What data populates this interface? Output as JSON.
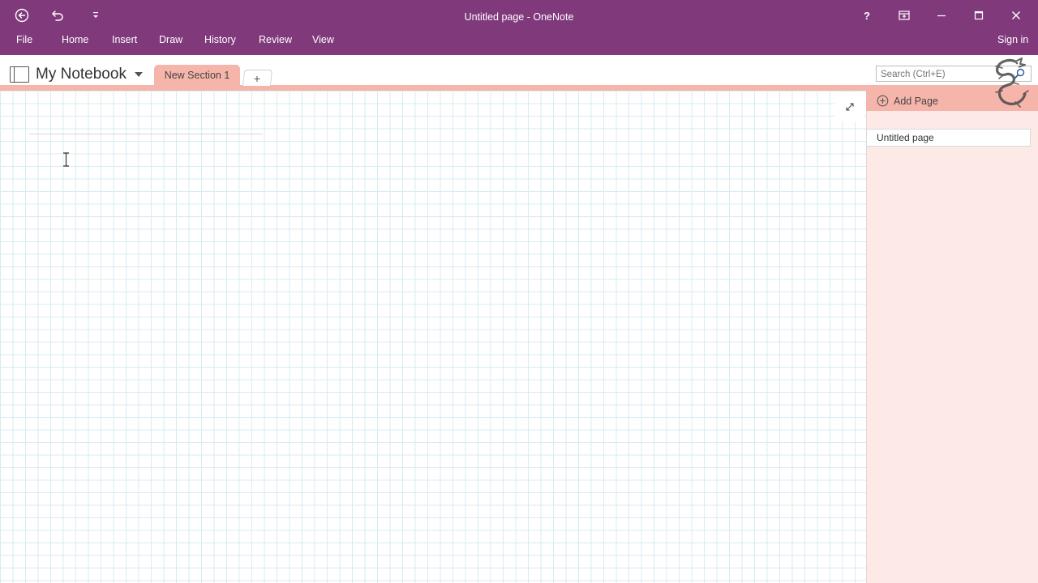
{
  "window": {
    "title": "Untitled page - OneNote"
  },
  "quick_access": {
    "back_icon": "back-arrow-circle-icon",
    "undo_icon": "undo-icon",
    "customize_icon": "customize-toolbar-icon"
  },
  "window_controls": {
    "help": "?",
    "full_screen_icon": "full-screen-icon",
    "minimize_icon": "minimize-icon",
    "maximize_icon": "maximize-icon",
    "close_icon": "close-icon"
  },
  "menu": {
    "file": "File",
    "home": "Home",
    "insert": "Insert",
    "draw": "Draw",
    "history": "History",
    "review": "Review",
    "view": "View",
    "sign_in": "Sign in"
  },
  "notebook": {
    "name": "My Notebook",
    "sections": [
      {
        "label": "New Section 1",
        "active": true
      }
    ],
    "add_section": "+"
  },
  "search": {
    "placeholder": "Search (Ctrl+E)"
  },
  "pages": {
    "add_page": "Add Page",
    "items": [
      {
        "label": "Untitled page",
        "selected": true
      }
    ]
  },
  "colors": {
    "ribbon": "#80397b",
    "section_tab": "#f5b5aa",
    "pages_pane": "#fdeae7",
    "grid_line": "#d7ecf3"
  }
}
